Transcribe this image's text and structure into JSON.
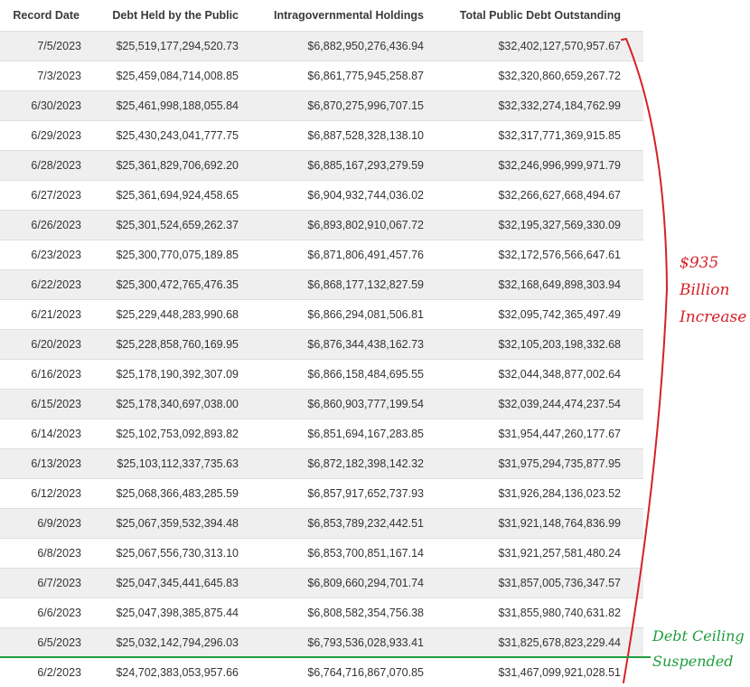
{
  "table": {
    "headers": {
      "record_date": "Record Date",
      "debt_public": "Debt Held by the Public",
      "intragov": "Intragovernmental Holdings",
      "total": "Total Public Debt Outstanding"
    },
    "rows": [
      {
        "date": "7/5/2023",
        "public": "$25,519,177,294,520.73",
        "intragov": "$6,882,950,276,436.94",
        "total": "$32,402,127,570,957.67"
      },
      {
        "date": "7/3/2023",
        "public": "$25,459,084,714,008.85",
        "intragov": "$6,861,775,945,258.87",
        "total": "$32,320,860,659,267.72"
      },
      {
        "date": "6/30/2023",
        "public": "$25,461,998,188,055.84",
        "intragov": "$6,870,275,996,707.15",
        "total": "$32,332,274,184,762.99"
      },
      {
        "date": "6/29/2023",
        "public": "$25,430,243,041,777.75",
        "intragov": "$6,887,528,328,138.10",
        "total": "$32,317,771,369,915.85"
      },
      {
        "date": "6/28/2023",
        "public": "$25,361,829,706,692.20",
        "intragov": "$6,885,167,293,279.59",
        "total": "$32,246,996,999,971.79"
      },
      {
        "date": "6/27/2023",
        "public": "$25,361,694,924,458.65",
        "intragov": "$6,904,932,744,036.02",
        "total": "$32,266,627,668,494.67"
      },
      {
        "date": "6/26/2023",
        "public": "$25,301,524,659,262.37",
        "intragov": "$6,893,802,910,067.72",
        "total": "$32,195,327,569,330.09"
      },
      {
        "date": "6/23/2023",
        "public": "$25,300,770,075,189.85",
        "intragov": "$6,871,806,491,457.76",
        "total": "$32,172,576,566,647.61"
      },
      {
        "date": "6/22/2023",
        "public": "$25,300,472,765,476.35",
        "intragov": "$6,868,177,132,827.59",
        "total": "$32,168,649,898,303.94"
      },
      {
        "date": "6/21/2023",
        "public": "$25,229,448,283,990.68",
        "intragov": "$6,866,294,081,506.81",
        "total": "$32,095,742,365,497.49"
      },
      {
        "date": "6/20/2023",
        "public": "$25,228,858,760,169.95",
        "intragov": "$6,876,344,438,162.73",
        "total": "$32,105,203,198,332.68"
      },
      {
        "date": "6/16/2023",
        "public": "$25,178,190,392,307.09",
        "intragov": "$6,866,158,484,695.55",
        "total": "$32,044,348,877,002.64"
      },
      {
        "date": "6/15/2023",
        "public": "$25,178,340,697,038.00",
        "intragov": "$6,860,903,777,199.54",
        "total": "$32,039,244,474,237.54"
      },
      {
        "date": "6/14/2023",
        "public": "$25,102,753,092,893.82",
        "intragov": "$6,851,694,167,283.85",
        "total": "$31,954,447,260,177.67"
      },
      {
        "date": "6/13/2023",
        "public": "$25,103,112,337,735.63",
        "intragov": "$6,872,182,398,142.32",
        "total": "$31,975,294,735,877.95"
      },
      {
        "date": "6/12/2023",
        "public": "$25,068,366,483,285.59",
        "intragov": "$6,857,917,652,737.93",
        "total": "$31,926,284,136,023.52"
      },
      {
        "date": "6/9/2023",
        "public": "$25,067,359,532,394.48",
        "intragov": "$6,853,789,232,442.51",
        "total": "$31,921,148,764,836.99"
      },
      {
        "date": "6/8/2023",
        "public": "$25,067,556,730,313.10",
        "intragov": "$6,853,700,851,167.14",
        "total": "$31,921,257,581,480.24"
      },
      {
        "date": "6/7/2023",
        "public": "$25,047,345,441,645.83",
        "intragov": "$6,809,660,294,701.74",
        "total": "$31,857,005,736,347.57"
      },
      {
        "date": "6/6/2023",
        "public": "$25,047,398,385,875.44",
        "intragov": "$6,808,582,354,756.38",
        "total": "$31,855,980,740,631.82"
      },
      {
        "date": "6/5/2023",
        "public": "$25,032,142,794,296.03",
        "intragov": "$6,793,536,028,933.41",
        "total": "$31,825,678,823,229.44"
      },
      {
        "date": "6/2/2023",
        "public": "$24,702,383,053,957.66",
        "intragov": "$6,764,716,867,070.85",
        "total": "$31,467,099,921,028.51"
      }
    ]
  },
  "annotations": {
    "increase": {
      "line1": "$935",
      "line2": "Billion",
      "line3": "Increase",
      "color": "#d62128"
    },
    "ceiling": {
      "line1": "Debt Ceiling",
      "line2": "Suspended",
      "color": "#1f9e3e"
    }
  },
  "colors": {
    "row_shade": "#efefef",
    "row_white": "#ffffff",
    "divider": "#dedede"
  }
}
